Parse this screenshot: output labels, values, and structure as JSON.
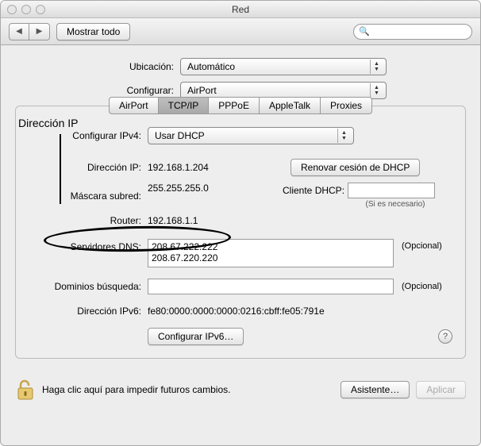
{
  "window": {
    "title": "Red"
  },
  "toolbar": {
    "showall": "Mostrar todo",
    "search_placeholder": ""
  },
  "top": {
    "location_label": "Ubicación:",
    "location_value": "Automático",
    "configure_label": "Configurar:",
    "configure_value": "AirPort"
  },
  "tabs": {
    "airport": "AirPort",
    "tcpip": "TCP/IP",
    "pppoe": "PPPoE",
    "appletalk": "AppleTalk",
    "proxies": "Proxies"
  },
  "ipv4": {
    "config_label": "Configurar IPv4:",
    "config_value": "Usar DHCP",
    "ip_label": "Dirección IP:",
    "ip_value": "192.168.1.204",
    "renew_btn": "Renovar cesión de DHCP",
    "subnet_label": "Máscara subred:",
    "subnet_value": "255.255.255.0",
    "dhcp_client_label": "Cliente DHCP:",
    "dhcp_client_value": "",
    "dhcp_client_hint": "(Si es necesario)",
    "router_label": "Router:",
    "router_value": "192.168.1.1",
    "dns_label": "Servidores DNS:",
    "dns_value": "208.67.222.222\n208.67.220.220",
    "dns_hint": "(Opcional)",
    "search_label": "Dominios búsqueda:",
    "search_value": "",
    "search_hint": "(Opcional)",
    "ipv6_label": "Dirección IPv6:",
    "ipv6_value": "fe80:0000:0000:0000:0216:cbff:fe05:791e",
    "ipv6_btn": "Configurar IPv6…"
  },
  "footer": {
    "lock_text": "Haga clic aquí para impedir futuros cambios.",
    "assistant_btn": "Asistente…",
    "apply_btn": "Aplicar"
  },
  "annotation": "Dirección IP",
  "help_glyph": "?"
}
